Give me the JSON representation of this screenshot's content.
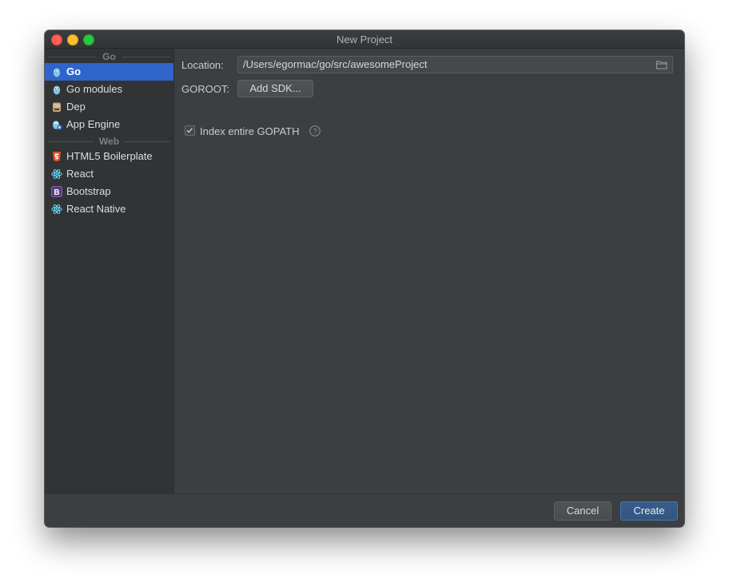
{
  "window": {
    "title": "New Project"
  },
  "sidebar": {
    "groups": [
      {
        "header": "Go",
        "items": [
          {
            "label": "Go",
            "icon": "gopher-icon",
            "selected": true
          },
          {
            "label": "Go modules",
            "icon": "gopher-icon"
          },
          {
            "label": "Dep",
            "icon": "dep-icon"
          },
          {
            "label": "App Engine",
            "icon": "app-engine-icon"
          }
        ]
      },
      {
        "header": "Web",
        "items": [
          {
            "label": "HTML5 Boilerplate",
            "icon": "html5-icon"
          },
          {
            "label": "React",
            "icon": "react-icon"
          },
          {
            "label": "Bootstrap",
            "icon": "bootstrap-icon"
          },
          {
            "label": "React Native",
            "icon": "react-icon"
          }
        ]
      }
    ]
  },
  "form": {
    "location_label": "Location:",
    "location_value": "/Users/egormac/go/src/awesomeProject",
    "goroot_label": "GOROOT:",
    "add_sdk_label": "Add SDK...",
    "index_gopath_label": "Index entire GOPATH",
    "index_gopath_checked": true
  },
  "footer": {
    "cancel_label": "Cancel",
    "create_label": "Create"
  },
  "colors": {
    "selection": "#2f65ca",
    "create_button": "#365a86",
    "background": "#3c3f41",
    "sidebar": "#313335"
  }
}
